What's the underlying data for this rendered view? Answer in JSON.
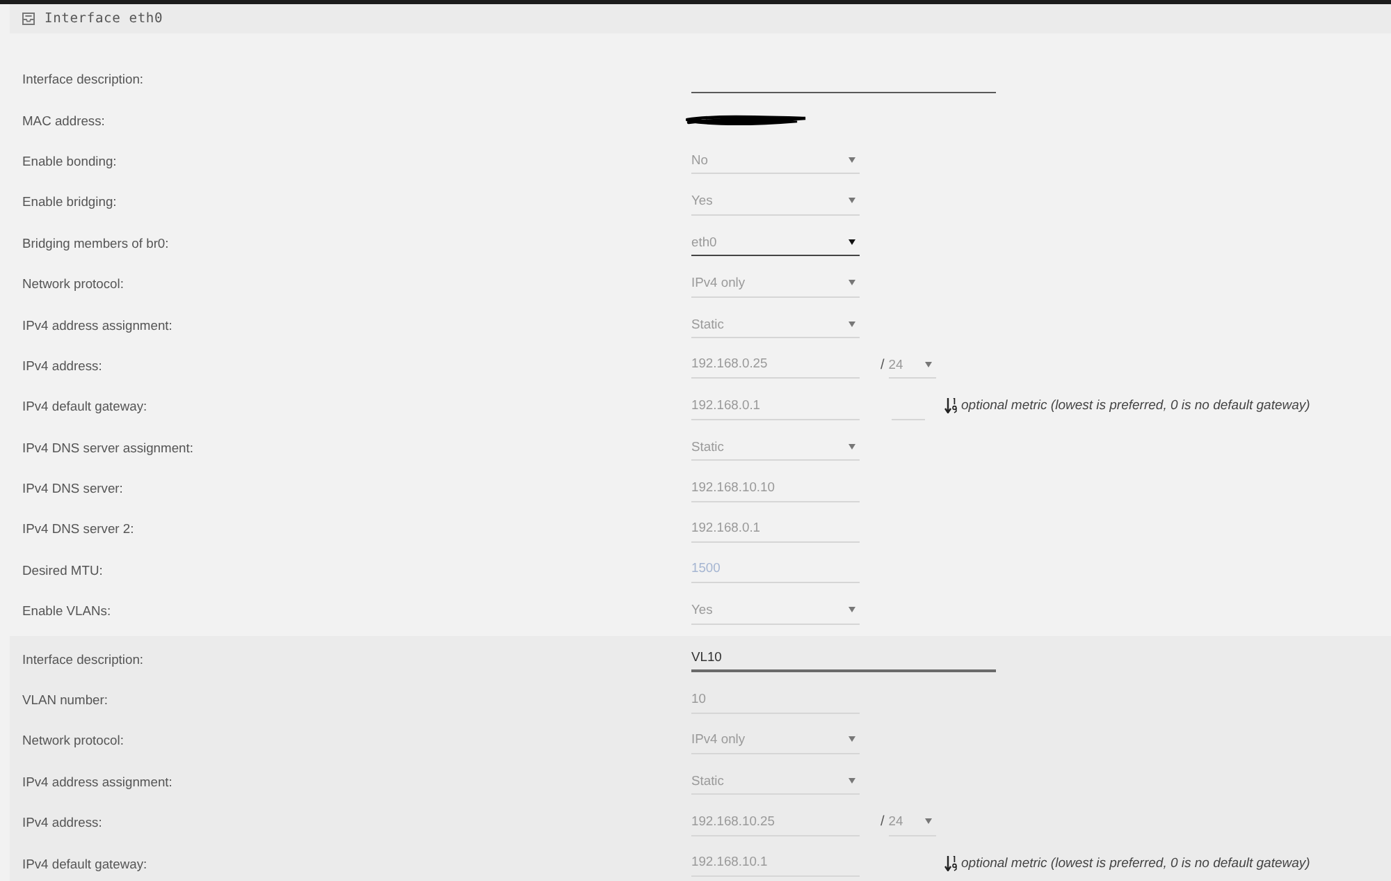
{
  "header": {
    "title": "Interface eth0"
  },
  "interface": {
    "rows": [
      {
        "kind": "description",
        "label": "Interface description:",
        "focused": false
      },
      {
        "kind": "redacted",
        "label": "MAC address:"
      },
      {
        "kind": "select",
        "label": "Enable bonding:",
        "value": "No",
        "focused": false
      },
      {
        "kind": "select",
        "label": "Enable bridging:",
        "value": "Yes",
        "focused": false
      },
      {
        "kind": "select",
        "label": "Bridging members of br0:",
        "value": "eth0",
        "focused": true
      },
      {
        "kind": "select",
        "label": "Network protocol:",
        "value": "IPv4 only",
        "focused": false
      },
      {
        "kind": "select",
        "label": "IPv4 address assignment:",
        "value": "Static",
        "focused": false
      },
      {
        "kind": "address",
        "label": "IPv4 address:",
        "value": "192.168.0.25",
        "separator": "/",
        "prefix": "24"
      },
      {
        "kind": "gateway",
        "label": "IPv4 default gateway:",
        "value": "192.168.0.1",
        "metric_field": true,
        "hint": "optional metric (lowest is preferred, 0 is no default gateway)"
      },
      {
        "kind": "select",
        "label": "IPv4 DNS server assignment:",
        "value": "Static",
        "focused": false
      },
      {
        "kind": "text",
        "label": "IPv4 DNS server:",
        "value": "192.168.10.10"
      },
      {
        "kind": "text",
        "label": "IPv4 DNS server 2:",
        "value": "192.168.0.1"
      },
      {
        "kind": "text",
        "label": "Desired MTU:",
        "placeholder": "1500"
      },
      {
        "kind": "select",
        "label": "Enable VLANs:",
        "value": "Yes",
        "focused": false
      }
    ]
  },
  "vlan": {
    "rows": [
      {
        "kind": "description",
        "label": "Interface description:",
        "value": "VL10",
        "focused": true
      },
      {
        "kind": "text",
        "label": "VLAN number:",
        "value": "10"
      },
      {
        "kind": "select",
        "label": "Network protocol:",
        "value": "IPv4 only",
        "focused": false
      },
      {
        "kind": "select",
        "label": "IPv4 address assignment:",
        "value": "Static",
        "focused": false
      },
      {
        "kind": "address",
        "label": "IPv4 address:",
        "value": "192.168.10.25",
        "separator": "/",
        "prefix": "24"
      },
      {
        "kind": "gateway",
        "label": "IPv4 default gateway:",
        "value": "192.168.10.1",
        "metric_field": false,
        "hint": "optional metric (lowest is preferred, 0 is no default gateway)"
      }
    ]
  }
}
